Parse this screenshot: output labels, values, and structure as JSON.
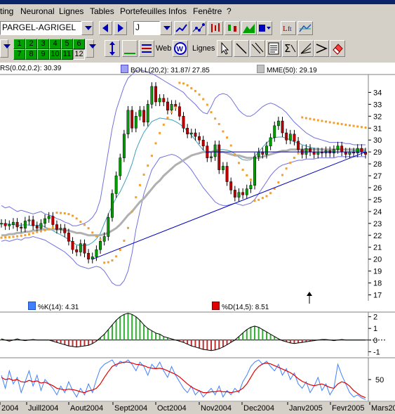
{
  "menu": [
    "ting",
    "Neuronal",
    "Lignes",
    "Tables",
    "Portefeuilles",
    "Infos",
    "Fenêtre",
    "?"
  ],
  "toolbar": {
    "security_value": "PARGEL-AGRIGEL",
    "period_value": "J",
    "web_label": "Web",
    "lines_label": "Lignes",
    "num_buttons_row1": [
      "1",
      "2",
      "3",
      "4",
      "5",
      "6"
    ],
    "num_buttons_row2": [
      "7",
      "8",
      "9",
      "10",
      "11",
      "12"
    ],
    "active_num": "12"
  },
  "legends": {
    "sar": "RS(0.02,0.2): 30.39",
    "boll": "BOLL(20,2): 31.87/ 27.85",
    "mme": "MME(50): 29.19",
    "stoch_k": "%K(14):  4.31",
    "stoch_d": "%D(14,5):  8.51"
  },
  "colors": {
    "boll": "#7070e0",
    "mme": "#b0b0b0",
    "sar": "#f0a030",
    "k": "#4080ff",
    "d": "#e00000",
    "up": "#00a000",
    "down": "#c00000",
    "trend": "#0000c0"
  },
  "x_labels": [
    "2004",
    "Juill2004",
    "Aout2004",
    "Sept2004",
    "Oct2004",
    "Nov2004",
    "Dec2004",
    "Janv2005",
    "Fevr2005",
    "Mars20"
  ],
  "chart_data": [
    {
      "type": "line",
      "y_ticks": [
        17,
        18,
        19,
        20,
        21,
        22,
        23,
        24,
        25,
        26,
        27,
        28,
        29,
        30,
        31,
        32,
        33,
        34
      ],
      "ylim": [
        16.5,
        35.5
      ],
      "close": [
        23.0,
        22.8,
        22.9,
        23.1,
        22.7,
        22.6,
        23.2,
        23.3,
        22.8,
        22.6,
        23.0,
        23.4,
        23.6,
        22.9,
        22.5,
        22.6,
        22.2,
        21.5,
        20.8,
        20.6,
        21.3,
        20.5,
        20.0,
        20.2,
        20.8,
        21.5,
        21.9,
        23.5,
        25.5,
        27.0,
        28.5,
        30.5,
        32.5,
        31.0,
        32.0,
        32.5,
        31.5,
        33.0,
        34.5,
        33.2,
        33.5,
        33.2,
        32.5,
        33.0,
        32.8,
        32.0,
        31.0,
        30.5,
        30.6,
        30.3,
        30.0,
        29.5,
        28.5,
        28.6,
        29.6,
        27.5,
        27.8,
        26.5,
        25.8,
        25.2,
        25.6,
        25.4,
        25.9,
        26.2,
        28.6,
        29.0,
        28.8,
        29.5,
        30.2,
        31.2,
        31.6,
        30.6,
        30.0,
        30.5,
        29.9,
        29.2,
        28.8,
        29.3,
        29.0,
        28.8,
        29.0,
        28.9,
        29.1,
        28.9,
        29.2,
        29.5,
        29.0,
        28.8,
        29.0,
        28.9,
        29.3,
        29.0,
        28.8
      ],
      "horizontal_line": 29.0,
      "trend_line": [
        [
          0,
          20.0
        ],
        [
          92,
          29.0
        ]
      ],
      "series": [
        {
          "name": "BOLL(20,2)",
          "upper": [
            24.5,
            24.3,
            24.4,
            24.2,
            24.0,
            24.1,
            24.0,
            23.9,
            23.8,
            23.9,
            24.0,
            23.8,
            23.7,
            23.6,
            23.4,
            23.3,
            23.1,
            23.0,
            22.8,
            22.8,
            22.9,
            23.0,
            23.2,
            23.5,
            24.0,
            25.0,
            27.0,
            29.0,
            31.0,
            32.5,
            33.5,
            34.5,
            35.2,
            35.5,
            35.8,
            35.9,
            35.8,
            35.7,
            35.6,
            35.4,
            35.2,
            35.0,
            34.8,
            34.6,
            34.4,
            34.2,
            34.0,
            33.6,
            33.3,
            33.0,
            32.6,
            32.3,
            32.2,
            32.8,
            33.5,
            33.8,
            33.9,
            33.8,
            33.5,
            33.0,
            32.5,
            32.2,
            32.0,
            32.0,
            32.2,
            32.5,
            32.8,
            33.0,
            33.1,
            33.0,
            32.8,
            32.6,
            32.3,
            31.9,
            31.5,
            31.2,
            30.9,
            30.6,
            30.4,
            30.2,
            30.1,
            30.0,
            29.9,
            29.8,
            29.8,
            29.8,
            29.8,
            29.7,
            29.7,
            29.6,
            29.6,
            29.6,
            29.6
          ],
          "lower": [
            21.5,
            21.6,
            21.5,
            21.6,
            21.7,
            21.6,
            21.8,
            21.8,
            21.9,
            21.8,
            21.7,
            21.6,
            21.4,
            21.2,
            21.0,
            20.8,
            20.6,
            20.3,
            20.0,
            19.6,
            19.4,
            19.3,
            19.2,
            19.3,
            19.4,
            19.3,
            19.0,
            18.5,
            18.0,
            17.8,
            17.8,
            18.2,
            19.0,
            20.5,
            22.5,
            24.0,
            25.5,
            26.5,
            27.5,
            28.0,
            28.5,
            28.6,
            28.7,
            28.8,
            28.7,
            28.5,
            28.2,
            27.9,
            27.5,
            27.0,
            26.5,
            26.0,
            25.6,
            25.2,
            24.8,
            24.6,
            24.5,
            24.5,
            24.6,
            24.7,
            24.6,
            24.5,
            24.6,
            24.7,
            25.0,
            25.5,
            26.0,
            26.5,
            27.0,
            27.4,
            27.7,
            27.9,
            28.0,
            28.1,
            28.2,
            28.3,
            28.3,
            28.4,
            28.4,
            28.4,
            28.5,
            28.5,
            28.5,
            28.5,
            28.5,
            28.6,
            28.6,
            28.6,
            28.6,
            28.6,
            28.6,
            28.6,
            28.6
          ]
        },
        {
          "name": "MME(50)",
          "values": [
            22.0,
            22.0,
            22.1,
            22.1,
            22.2,
            22.2,
            22.3,
            22.3,
            22.4,
            22.4,
            22.5,
            22.5,
            22.5,
            22.5,
            22.5,
            22.5,
            22.4,
            22.4,
            22.3,
            22.2,
            22.2,
            22.1,
            22.0,
            22.0,
            22.0,
            22.0,
            22.1,
            22.2,
            22.4,
            22.6,
            22.9,
            23.3,
            23.7,
            24.0,
            24.4,
            24.8,
            25.1,
            25.5,
            25.9,
            26.3,
            26.6,
            27.0,
            27.3,
            27.6,
            27.9,
            28.1,
            28.3,
            28.5,
            28.7,
            28.8,
            28.9,
            29.0,
            29.0,
            29.0,
            29.1,
            29.0,
            29.0,
            28.9,
            28.8,
            28.7,
            28.7,
            28.6,
            28.5,
            28.5,
            28.5,
            28.5,
            28.6,
            28.7,
            28.8,
            28.9,
            29.0,
            29.1,
            29.1,
            29.2,
            29.2,
            29.2,
            29.2,
            29.2,
            29.2,
            29.2,
            29.2,
            29.2,
            29.2,
            29.2,
            29.2,
            29.2,
            29.2,
            29.2,
            29.2,
            29.2,
            29.2,
            29.2,
            29.2
          ]
        }
      ]
    },
    {
      "type": "bar",
      "y_ticks": [
        -1,
        0,
        1,
        2
      ],
      "ylim": [
        -1.4,
        2.4
      ],
      "values": [
        0.1,
        0.0,
        -0.1,
        0.0,
        0.1,
        0.0,
        -0.05,
        0.0,
        0.05,
        0.0,
        0.0,
        0.0,
        0.0,
        -0.1,
        -0.2,
        -0.3,
        -0.4,
        -0.5,
        -0.55,
        -0.6,
        -0.55,
        -0.5,
        -0.45,
        -0.3,
        -0.1,
        0.2,
        0.5,
        0.9,
        1.3,
        1.7,
        2.0,
        2.2,
        2.3,
        2.2,
        2.0,
        1.7,
        1.3,
        1.0,
        0.8,
        0.6,
        0.5,
        0.3,
        0.2,
        0.1,
        0.0,
        -0.1,
        -0.2,
        -0.35,
        -0.5,
        -0.6,
        -0.7,
        -0.8,
        -0.85,
        -0.9,
        -0.85,
        -0.75,
        -0.6,
        -0.4,
        -0.2,
        0.0,
        0.3,
        0.6,
        0.9,
        1.1,
        1.2,
        1.1,
        0.9,
        0.7,
        0.5,
        0.3,
        0.1,
        -0.05,
        -0.15,
        -0.25,
        -0.3,
        -0.25,
        -0.2,
        -0.15,
        -0.1,
        -0.05,
        0.0,
        0.05,
        0.05,
        0.0,
        -0.05,
        0.0,
        0.05,
        0.0,
        0.0,
        0.0,
        0.0,
        0.0,
        0.0
      ]
    },
    {
      "type": "line",
      "y_ticks": [
        50
      ],
      "ylim": [
        0,
        100
      ],
      "series": [
        {
          "name": "%K(14)",
          "values": [
            60,
            30,
            70,
            40,
            55,
            20,
            45,
            70,
            35,
            60,
            25,
            50,
            40,
            30,
            15,
            35,
            20,
            45,
            25,
            10,
            30,
            15,
            40,
            20,
            50,
            75,
            85,
            90,
            95,
            80,
            92,
            88,
            95,
            85,
            70,
            90,
            80,
            60,
            85,
            75,
            90,
            70,
            55,
            80,
            60,
            45,
            30,
            20,
            35,
            15,
            25,
            10,
            20,
            30,
            15,
            35,
            10,
            25,
            15,
            30,
            20,
            45,
            60,
            80,
            90,
            95,
            85,
            92,
            80,
            70,
            85,
            60,
            75,
            50,
            65,
            40,
            30,
            45,
            20,
            35,
            55,
            25,
            40,
            15,
            30,
            85,
            60,
            40,
            20,
            10,
            15,
            8,
            4.31
          ]
        },
        {
          "name": "%D(14,5)",
          "values": [
            55,
            50,
            52,
            48,
            50,
            45,
            44,
            48,
            45,
            47,
            42,
            44,
            40,
            36,
            30,
            28,
            26,
            28,
            27,
            25,
            22,
            20,
            24,
            26,
            30,
            40,
            55,
            68,
            80,
            85,
            88,
            90,
            90,
            88,
            85,
            84,
            82,
            78,
            76,
            75,
            76,
            74,
            70,
            66,
            62,
            56,
            48,
            40,
            33,
            28,
            24,
            20,
            20,
            22,
            22,
            24,
            22,
            22,
            20,
            22,
            24,
            30,
            40,
            55,
            70,
            80,
            86,
            88,
            86,
            82,
            78,
            74,
            70,
            66,
            60,
            52,
            46,
            42,
            38,
            36,
            38,
            40,
            36,
            32,
            30,
            40,
            45,
            42,
            35,
            25,
            18,
            12,
            8.51
          ]
        }
      ]
    }
  ]
}
